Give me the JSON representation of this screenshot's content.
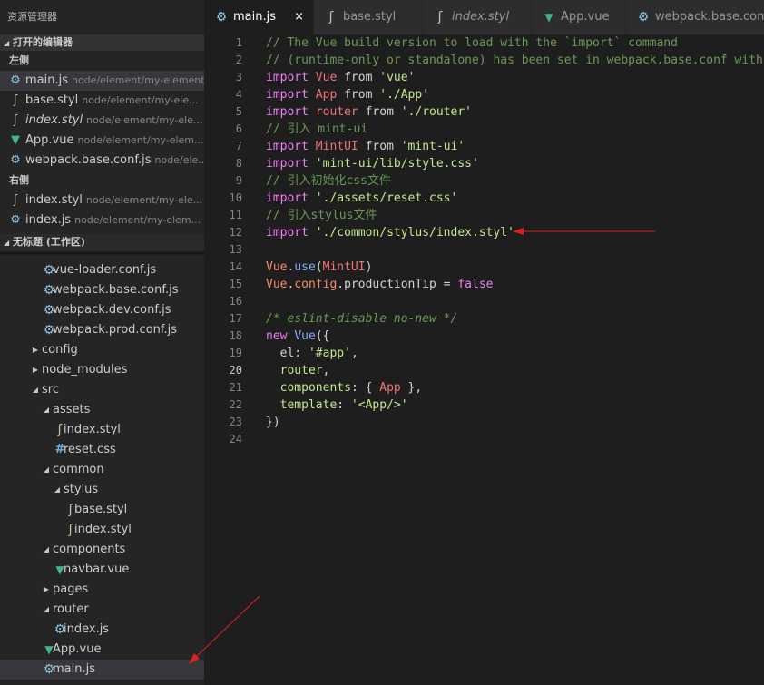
{
  "sidebar": {
    "title": "资源管理器",
    "open_editors": {
      "header": "打开的编辑器",
      "groups": [
        {
          "label": "左侧",
          "items": [
            {
              "name": "main.js",
              "desc": "node/element/my-element...",
              "icon": "gear-icon",
              "active": true,
              "italic": false
            },
            {
              "name": "base.styl",
              "desc": "node/element/my-ele...",
              "icon": "stylus-icon",
              "active": false,
              "italic": false
            },
            {
              "name": "index.styl",
              "desc": "node/element/my-ele...",
              "icon": "stylus-icon",
              "active": false,
              "italic": true
            },
            {
              "name": "App.vue",
              "desc": "node/element/my-elem...",
              "icon": "vue-icon",
              "active": false,
              "italic": false
            },
            {
              "name": "webpack.base.conf.js",
              "desc": "node/ele...",
              "icon": "gear-icon",
              "active": false,
              "italic": false
            }
          ]
        },
        {
          "label": "右侧",
          "items": [
            {
              "name": "index.styl",
              "desc": "node/element/my-ele...",
              "icon": "stylus-icon",
              "active": false,
              "italic": false
            },
            {
              "name": "index.js",
              "desc": "node/element/my-elem...",
              "icon": "gear-icon",
              "active": false,
              "italic": false
            }
          ]
        }
      ]
    },
    "workspace": {
      "header": "无标题 (工作区)",
      "tree": [
        {
          "name": "vue-loader.conf.js",
          "depth": 4,
          "type": "file",
          "icon": "gear-icon"
        },
        {
          "name": "webpack.base.conf.js",
          "depth": 4,
          "type": "file",
          "icon": "gear-icon"
        },
        {
          "name": "webpack.dev.conf.js",
          "depth": 4,
          "type": "file",
          "icon": "gear-icon"
        },
        {
          "name": "webpack.prod.conf.js",
          "depth": 4,
          "type": "file",
          "icon": "gear-icon"
        },
        {
          "name": "config",
          "depth": 3,
          "type": "folder-closed"
        },
        {
          "name": "node_modules",
          "depth": 3,
          "type": "folder-closed"
        },
        {
          "name": "src",
          "depth": 3,
          "type": "folder-open"
        },
        {
          "name": "assets",
          "depth": 4,
          "type": "folder-open"
        },
        {
          "name": "index.styl",
          "depth": 5,
          "type": "file",
          "icon": "stylus-icon"
        },
        {
          "name": "reset.css",
          "depth": 5,
          "type": "file",
          "icon": "hash-icon"
        },
        {
          "name": "common",
          "depth": 4,
          "type": "folder-open"
        },
        {
          "name": "stylus",
          "depth": 5,
          "type": "folder-open"
        },
        {
          "name": "base.styl",
          "depth": 6,
          "type": "file",
          "icon": "stylus-icon"
        },
        {
          "name": "index.styl",
          "depth": 6,
          "type": "file",
          "icon": "stylus-icon"
        },
        {
          "name": "components",
          "depth": 4,
          "type": "folder-open"
        },
        {
          "name": "navbar.vue",
          "depth": 5,
          "type": "file",
          "icon": "vue-icon"
        },
        {
          "name": "pages",
          "depth": 4,
          "type": "folder-closed"
        },
        {
          "name": "router",
          "depth": 4,
          "type": "folder-open"
        },
        {
          "name": "index.js",
          "depth": 5,
          "type": "file",
          "icon": "gear-icon"
        },
        {
          "name": "App.vue",
          "depth": 4,
          "type": "file",
          "icon": "vue-icon"
        },
        {
          "name": "main.js",
          "depth": 4,
          "type": "file",
          "icon": "gear-icon",
          "active": true
        }
      ]
    }
  },
  "tabs": [
    {
      "label": "main.js",
      "icon": "gear-icon",
      "active": true,
      "italic": false,
      "close": "×"
    },
    {
      "label": "base.styl",
      "icon": "stylus-icon",
      "active": false,
      "italic": false
    },
    {
      "label": "index.styl",
      "icon": "stylus-icon",
      "active": false,
      "italic": true
    },
    {
      "label": "App.vue",
      "icon": "vue-icon",
      "active": false,
      "italic": false
    },
    {
      "label": "webpack.base.conf.js",
      "icon": "gear-icon",
      "active": false,
      "italic": false
    }
  ],
  "editor": {
    "current_line": 20,
    "lines": [
      [
        [
          "c",
          "// The Vue build version to load with the `import` command"
        ]
      ],
      [
        [
          "c",
          "// (runtime-only or standalone) has been set in webpack.base.conf with an alias."
        ]
      ],
      [
        [
          "k",
          "import "
        ],
        [
          "v",
          "Vue"
        ],
        [
          "p",
          " from "
        ],
        [
          "s",
          "'vue'"
        ]
      ],
      [
        [
          "k",
          "import "
        ],
        [
          "v",
          "App"
        ],
        [
          "p",
          " from "
        ],
        [
          "s",
          "'./App'"
        ]
      ],
      [
        [
          "k",
          "import "
        ],
        [
          "v",
          "router"
        ],
        [
          "p",
          " from "
        ],
        [
          "s",
          "'./router'"
        ]
      ],
      [
        [
          "c",
          "// 引入 mint-ui"
        ]
      ],
      [
        [
          "k",
          "import "
        ],
        [
          "v",
          "MintUI"
        ],
        [
          "p",
          " from "
        ],
        [
          "s",
          "'mint-ui'"
        ]
      ],
      [
        [
          "k",
          "import "
        ],
        [
          "s",
          "'mint-ui/lib/style.css'"
        ]
      ],
      [
        [
          "c",
          "// 引入初始化css文件"
        ]
      ],
      [
        [
          "k",
          "import "
        ],
        [
          "s",
          "'./assets/reset.css'"
        ]
      ],
      [
        [
          "c",
          "// 引入stylus文件"
        ]
      ],
      [
        [
          "k",
          "import "
        ],
        [
          "s",
          "'./common/stylus/index.styl'"
        ]
      ],
      [],
      [
        [
          "f2",
          "Vue"
        ],
        [
          "p",
          "."
        ],
        [
          "f",
          "use"
        ],
        [
          "p",
          "("
        ],
        [
          "v",
          "MintUI"
        ],
        [
          "p",
          ")"
        ]
      ],
      [
        [
          "f2",
          "Vue"
        ],
        [
          "p",
          "."
        ],
        [
          "f2",
          "config"
        ],
        [
          "p",
          ".productionTip = "
        ],
        [
          "k",
          "false"
        ]
      ],
      [],
      [
        [
          "i",
          "/* eslint-disable no-new */"
        ]
      ],
      [
        [
          "k",
          "new "
        ],
        [
          "f",
          "Vue"
        ],
        [
          "p",
          "({"
        ]
      ],
      [
        [
          "p",
          "  el: "
        ],
        [
          "s",
          "'#app'"
        ],
        [
          "p",
          ","
        ]
      ],
      [
        [
          "p",
          "  "
        ],
        [
          "prop",
          "router"
        ],
        [
          "p",
          ","
        ]
      ],
      [
        [
          "p",
          "  "
        ],
        [
          "prop",
          "components"
        ],
        [
          "p",
          ": { "
        ],
        [
          "v",
          "App"
        ],
        [
          "p",
          " },"
        ]
      ],
      [
        [
          "p",
          "  "
        ],
        [
          "prop",
          "template"
        ],
        [
          "p",
          ": "
        ],
        [
          "s",
          "'<App/>'"
        ]
      ],
      [
        [
          "p",
          "})"
        ]
      ],
      []
    ]
  },
  "colors": {
    "annotation_arrow": "#e0201a",
    "accent": "#41b883"
  }
}
